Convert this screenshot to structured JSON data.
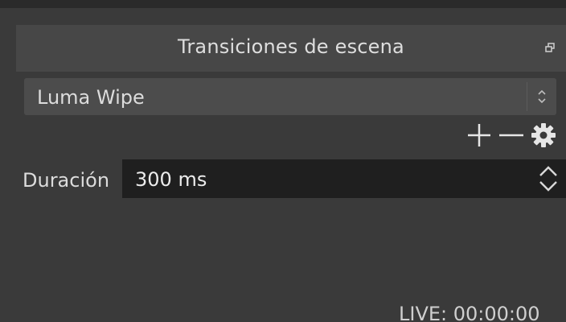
{
  "dock": {
    "title": "Transiciones de escena",
    "float_icon": "float-dock-icon"
  },
  "transition": {
    "selected": "Luma Wipe",
    "arrows_icon": "combo-updown-icon"
  },
  "toolbar": {
    "add_icon": "plus-icon",
    "remove_icon": "minus-icon",
    "settings_icon": "gear-icon"
  },
  "duration": {
    "label": "Duración",
    "value": "300 ms"
  },
  "status": {
    "live": "LIVE: 00:00:00"
  },
  "colors": {
    "background": "#3a3a3a",
    "title_bar": "#474747",
    "combo_bg": "#4c4c4c",
    "spin_bg": "#1f1f1f",
    "text": "#dcdcdc"
  }
}
